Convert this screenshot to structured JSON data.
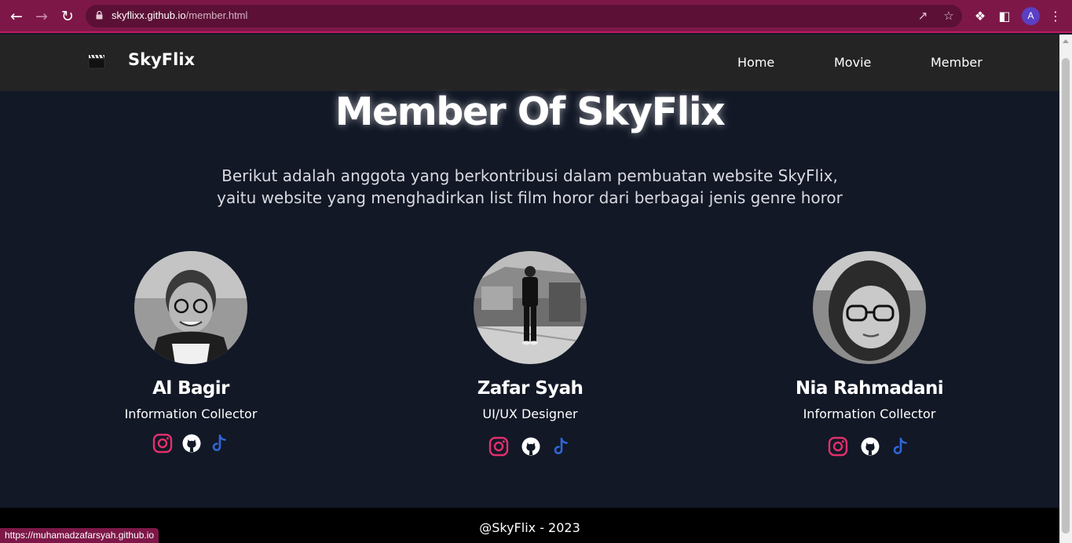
{
  "browser": {
    "url_host": "skyflixx.github.io",
    "url_path": "/member.html",
    "profile_initial": "A",
    "status_url": "https://muhamadzafarsyah.github.io"
  },
  "nav": {
    "brand": "SkyFlix",
    "items": [
      {
        "label": "Home"
      },
      {
        "label": "Movie"
      },
      {
        "label": "Member"
      }
    ]
  },
  "hero": {
    "title": "Member Of SkyFlix",
    "desc_line1": "Berikut adalah anggota yang berkontribusi dalam pembuatan website SkyFlix,",
    "desc_line2": "yaitu website yang menghadirkan list film horor dari berbagai jenis genre horor"
  },
  "members": [
    {
      "name": "Al Bagir",
      "role": "Information Collector"
    },
    {
      "name": "Zafar Syah",
      "role": "UI/UX Designer"
    },
    {
      "name": "Nia Rahmadani",
      "role": "Information Collector"
    }
  ],
  "social_icons": [
    "instagram-icon",
    "github-icon",
    "tiktok-icon"
  ],
  "colors": {
    "chrome": "#7d1748",
    "page_bg": "#121826",
    "navbar_bg": "#242424",
    "footer_bg": "#000000",
    "instagram": "#e1306c",
    "tiktok": "#2f66d6"
  },
  "footer": {
    "text": "@SkyFlix - 2023"
  }
}
